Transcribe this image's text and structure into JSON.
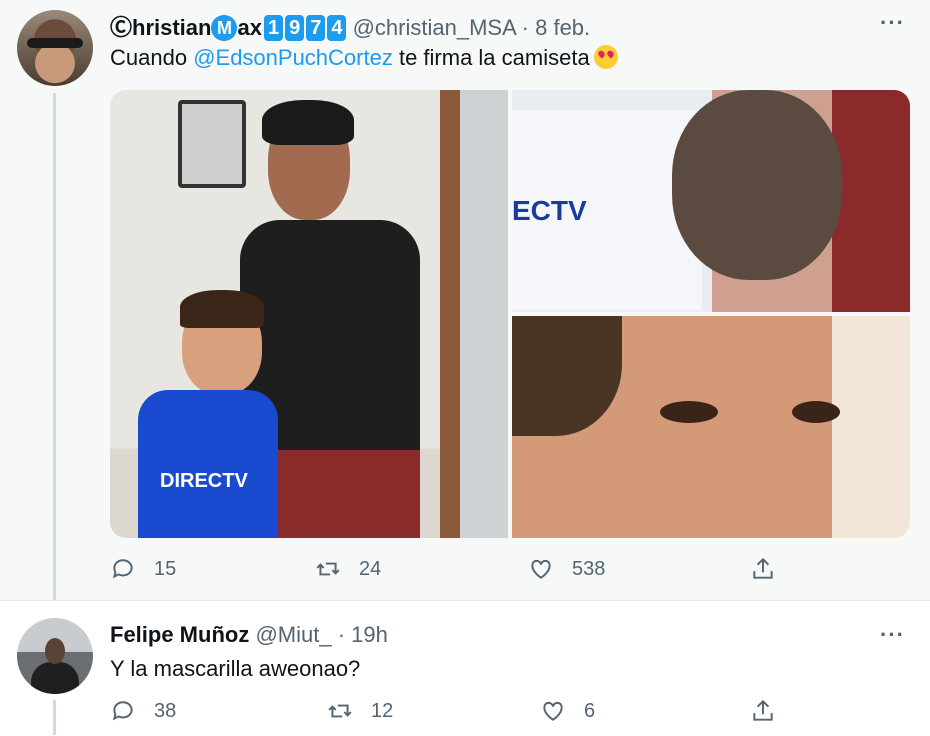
{
  "tweet1": {
    "name_main": "Ⓒhristian",
    "name_badge_m": "M",
    "name_ax": "ax",
    "name_digits": [
      "1",
      "9",
      "7",
      "4"
    ],
    "handle": "@christian_MSA",
    "separator": "·",
    "time": "8 feb.",
    "more": "···",
    "text_before": "Cuando ",
    "mention": "@EdsonPuchCortez",
    "text_after": " te firma la camiseta",
    "emoji": "heart-eyes",
    "image_left_shirt": "DIRECTV",
    "image_tr_shirt": "ECTV",
    "actions": {
      "reply": "15",
      "retweet": "24",
      "like": "538"
    }
  },
  "tweet2": {
    "name": "Felipe Muñoz",
    "handle": "@Miut_",
    "separator": "·",
    "time": "19h",
    "more": "···",
    "text": "Y la mascarilla aweonao?",
    "actions": {
      "reply": "38",
      "retweet": "12",
      "like": "6"
    }
  },
  "colors": {
    "accent": "#1d9bf0",
    "muted": "#536471",
    "text": "#0f1419",
    "bg_focus": "#f7f9f9"
  },
  "icons": [
    "reply-icon",
    "retweet-icon",
    "like-icon",
    "share-icon",
    "more-icon"
  ]
}
